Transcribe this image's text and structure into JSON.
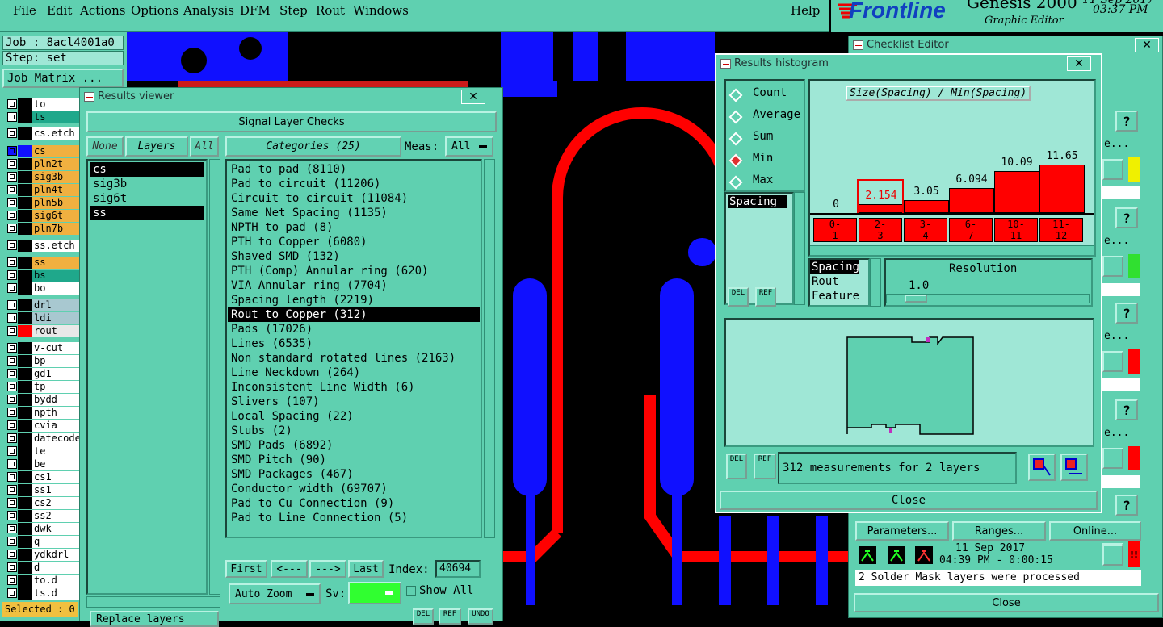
{
  "menu": [
    "File",
    "Edit",
    "Actions",
    "Options",
    "Analysis",
    "DFM",
    "Step",
    "Rout",
    "Windows"
  ],
  "help": "Help",
  "brand": {
    "logo": "Frontline",
    "product": "Genesis 2000",
    "subtitle": "Graphic Editor",
    "date": "11 Sep 2017",
    "time": "03:37 PM"
  },
  "job": {
    "job_label": "Job : 8acl4001a0",
    "step_label": "Step: set",
    "matrix_button": "Job Matrix ...",
    "selected": "Selected : 0",
    "replace_layers": "Replace layers"
  },
  "layers": [
    {
      "name": "to",
      "color": "#ffffff"
    },
    {
      "name": "ts",
      "color": "#1fa88b"
    },
    {
      "name": "cs.etch",
      "color": "#ffffff"
    },
    {
      "name": "cs",
      "color": "#f0b040"
    },
    {
      "name": "pln2t",
      "color": "#f0b040"
    },
    {
      "name": "sig3b",
      "color": "#f0b040"
    },
    {
      "name": "pln4t",
      "color": "#f0b040"
    },
    {
      "name": "pln5b",
      "color": "#f0b040"
    },
    {
      "name": "sig6t",
      "color": "#f0b040"
    },
    {
      "name": "pln7b",
      "color": "#f0b040"
    },
    {
      "name": "ss.etch",
      "color": "#ffffff"
    },
    {
      "name": "ss",
      "color": "#f0b040"
    },
    {
      "name": "bs",
      "color": "#1fa88b"
    },
    {
      "name": "bo",
      "color": "#ffffff"
    },
    {
      "name": "drl",
      "color": "#a8c8d0"
    },
    {
      "name": "ldi",
      "color": "#a8c8d0"
    },
    {
      "name": "rout",
      "color": "#e8e8e8"
    },
    {
      "name": "v-cut",
      "color": "#ffffff"
    },
    {
      "name": "bp",
      "color": "#ffffff"
    },
    {
      "name": "gd1",
      "color": "#ffffff"
    },
    {
      "name": "tp",
      "color": "#ffffff"
    },
    {
      "name": "bydd",
      "color": "#ffffff"
    },
    {
      "name": "npth",
      "color": "#ffffff"
    },
    {
      "name": "cvia",
      "color": "#ffffff"
    },
    {
      "name": "datecode",
      "color": "#ffffff"
    },
    {
      "name": "te",
      "color": "#ffffff"
    },
    {
      "name": "be",
      "color": "#ffffff"
    },
    {
      "name": "cs1",
      "color": "#ffffff"
    },
    {
      "name": "ss1",
      "color": "#ffffff"
    },
    {
      "name": "cs2",
      "color": "#ffffff"
    },
    {
      "name": "ss2",
      "color": "#ffffff"
    },
    {
      "name": "dwk",
      "color": "#ffffff"
    },
    {
      "name": "q",
      "color": "#ffffff"
    },
    {
      "name": "ydkdrl",
      "color": "#ffffff"
    },
    {
      "name": "d",
      "color": "#ffffff"
    },
    {
      "name": "to.d",
      "color": "#ffffff"
    },
    {
      "name": "ts.d",
      "color": "#ffffff"
    }
  ],
  "results_viewer": {
    "title": "Results viewer",
    "heading": "Signal Layer Checks",
    "none_btn": "None",
    "layers_btn": "Layers",
    "all_btn": "All",
    "categories_btn": "Categories (25)",
    "meas_label": "Meas:",
    "meas_value": "All",
    "layer_list": [
      "cs",
      "sig3b",
      "sig6t",
      "ss"
    ],
    "categories": [
      "Pad to pad (8110)",
      "Pad to circuit (11206)",
      "Circuit to circuit (11084)",
      "Same Net Spacing (1135)",
      "NPTH to pad (8)",
      "PTH to Copper (6080)",
      "Shaved SMD (132)",
      "PTH (Comp) Annular ring (620)",
      "VIA Annular ring (7704)",
      "Spacing length (2219)",
      "Rout to Copper (312)",
      "Pads (17026)",
      "Lines (6535)",
      "Non standard rotated lines (2163)",
      "Line Neckdown (264)",
      "Inconsistent Line Width (6)",
      "Slivers (107)",
      "Local Spacing (22)",
      "Stubs (2)",
      "SMD Pads (6892)",
      "SMD Pitch (90)",
      "SMD Packages (467)",
      "Conductor width (69707)",
      "Pad to Cu Connection (9)",
      "Pad to Line Connection (5)"
    ],
    "first": "First",
    "prev": "<---",
    "next": "--->",
    "last": "Last",
    "index_label": "Index:",
    "index_value": "40694",
    "auto_zoom": "Auto Zoom",
    "sv_label": "Sv:",
    "show_all": "Show All",
    "del": "DEL",
    "ref": "REF",
    "undo": "UNDO"
  },
  "histogram": {
    "title": "Results histogram",
    "radio": [
      "Count",
      "Average",
      "Sum",
      "Min",
      "Max"
    ],
    "selected_radio": "Min",
    "chart_title": "Size(Spacing) / Min(Spacing)",
    "values": [
      "0",
      "2.154",
      "3.05",
      "6.094",
      "10.09",
      "11.65"
    ],
    "bins": [
      [
        "0-",
        "1"
      ],
      [
        "2-",
        "3"
      ],
      [
        "3-",
        "4"
      ],
      [
        "6-",
        "7"
      ],
      [
        "10-",
        "11"
      ],
      [
        "11-",
        "12"
      ]
    ],
    "spacing_item": "Spacing",
    "meas_types": [
      "Spacing",
      "Rout",
      "Feature"
    ],
    "resolution_label": "Resolution",
    "resolution_value": "1.0",
    "del": "DEL",
    "ref": "REF",
    "status": "312 measurements for 2 layers",
    "close": "Close"
  },
  "checklist": {
    "title": "Checklist Editor",
    "parameters": "Parameters...",
    "ranges": "Ranges...",
    "online": "Online...",
    "date": "11 Sep 2017",
    "run_time": "04:39 PM - 0:00:15",
    "message": "2 Solder Mask layers were processed",
    "close": "Close",
    "help": "?",
    "more": "e..."
  },
  "colors": {
    "panel": "#5fd0b0",
    "trace_blue": "#1010ff",
    "trace_red": "#ff0000"
  }
}
